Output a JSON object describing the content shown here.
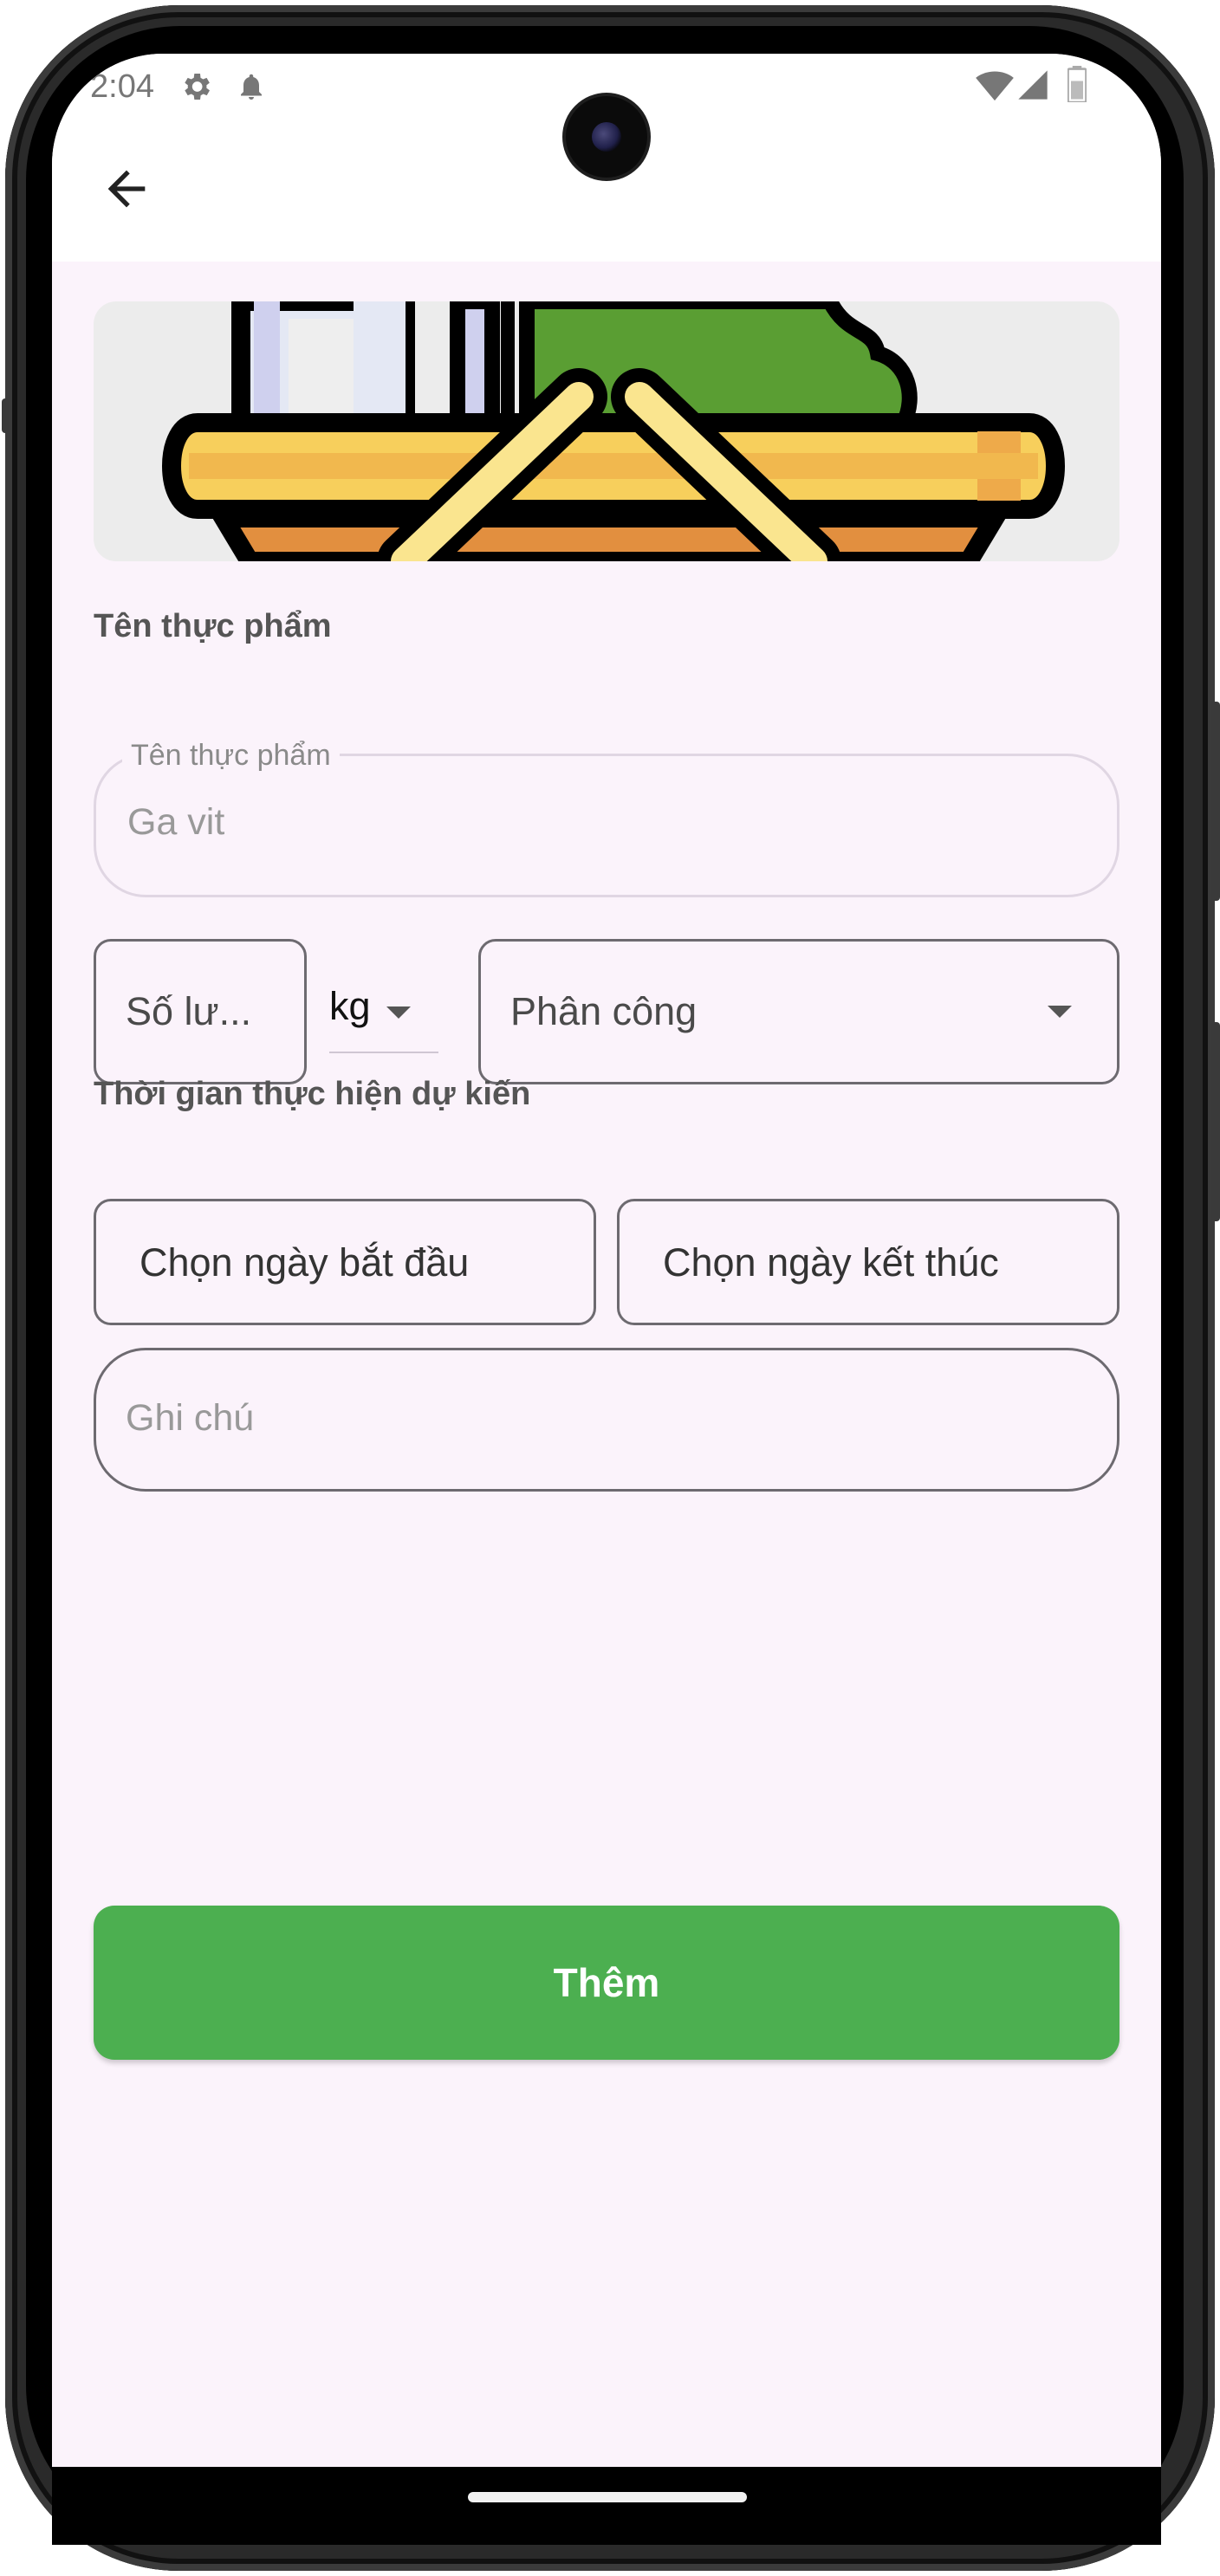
{
  "status_bar": {
    "time": "2:04",
    "icons": [
      "gear-icon",
      "bell-icon",
      "wifi-icon",
      "signal-icon",
      "battery-icon"
    ]
  },
  "app_bar": {
    "back_icon": "arrow-left-icon"
  },
  "form": {
    "food_name_section": "Tên thực phẩm",
    "food_name_label": "Tên thực phẩm",
    "food_name_value": "Ga vit",
    "quantity_placeholder": "Số lư...",
    "unit_value": "kg",
    "assign_placeholder": "Phân công",
    "time_section": "Thời gian thực hiện dự kiến",
    "start_date_button": "Chọn ngày bắt đầu",
    "end_date_button": "Chọn ngày kết thúc",
    "note_placeholder": "Ghi chú",
    "submit_button": "Thêm"
  },
  "colors": {
    "background": "#fbf3fb",
    "primary_button": "#4caf50",
    "border": "#6d6a70"
  }
}
